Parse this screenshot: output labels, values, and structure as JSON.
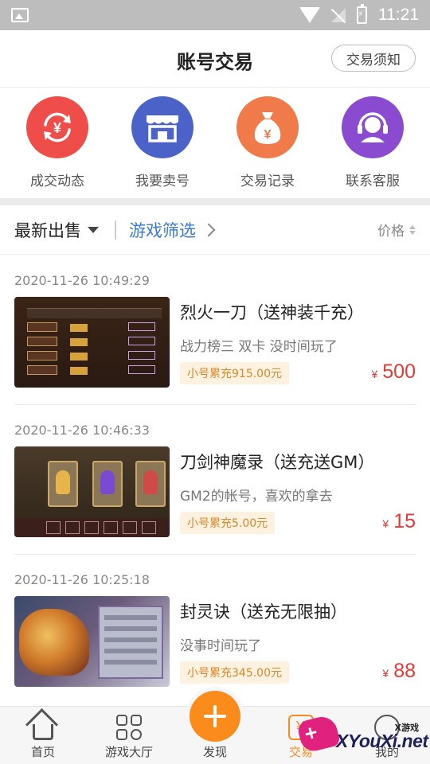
{
  "status_bar": {
    "time": "11:21"
  },
  "header": {
    "title": "账号交易",
    "notice_button": "交易须知"
  },
  "actions": [
    {
      "label": "成交动态",
      "icon": "exchange-yen-icon",
      "color": "#ef4d4a"
    },
    {
      "label": "我要卖号",
      "icon": "shop-icon",
      "color": "#4b63c9"
    },
    {
      "label": "交易记录",
      "icon": "money-bag-icon",
      "color": "#f07a4a"
    },
    {
      "label": "联系客服",
      "icon": "headset-service-icon",
      "color": "#8b4bd0"
    }
  ],
  "filter": {
    "latest": "最新出售",
    "game_filter": "游戏筛选",
    "price_sort": "价格"
  },
  "listings": [
    {
      "time": "2020-11-26 10:49:29",
      "name": "烈火一刀（送神装千充）",
      "desc": "战力榜三 双卡 没时间玩了",
      "tag": "小号累充915.00元",
      "currency": "¥",
      "price": "500"
    },
    {
      "time": "2020-11-26 10:46:33",
      "name": "刀剑神魔录（送充送GM）",
      "desc": "GM2的帐号，喜欢的拿去",
      "tag": "小号累充5.00元",
      "currency": "¥",
      "price": "15"
    },
    {
      "time": "2020-11-26 10:25:18",
      "name": "封灵诀（送充无限抽）",
      "desc": "没事时间玩了",
      "tag": "小号累充345.00元",
      "currency": "¥",
      "price": "88"
    }
  ],
  "bottom_nav": [
    {
      "label": "首页"
    },
    {
      "label": "游戏大厅"
    },
    {
      "label": "发现"
    },
    {
      "label": "交易"
    },
    {
      "label": "我的"
    }
  ],
  "watermark": {
    "site": "XYouXi.net",
    "small": "X游戏"
  },
  "colors": {
    "accent": "#fb8c1c",
    "price": "#e53935",
    "link": "#3a7bd5",
    "tag_bg": "#fdf1df",
    "tag_text": "#d9882a"
  }
}
